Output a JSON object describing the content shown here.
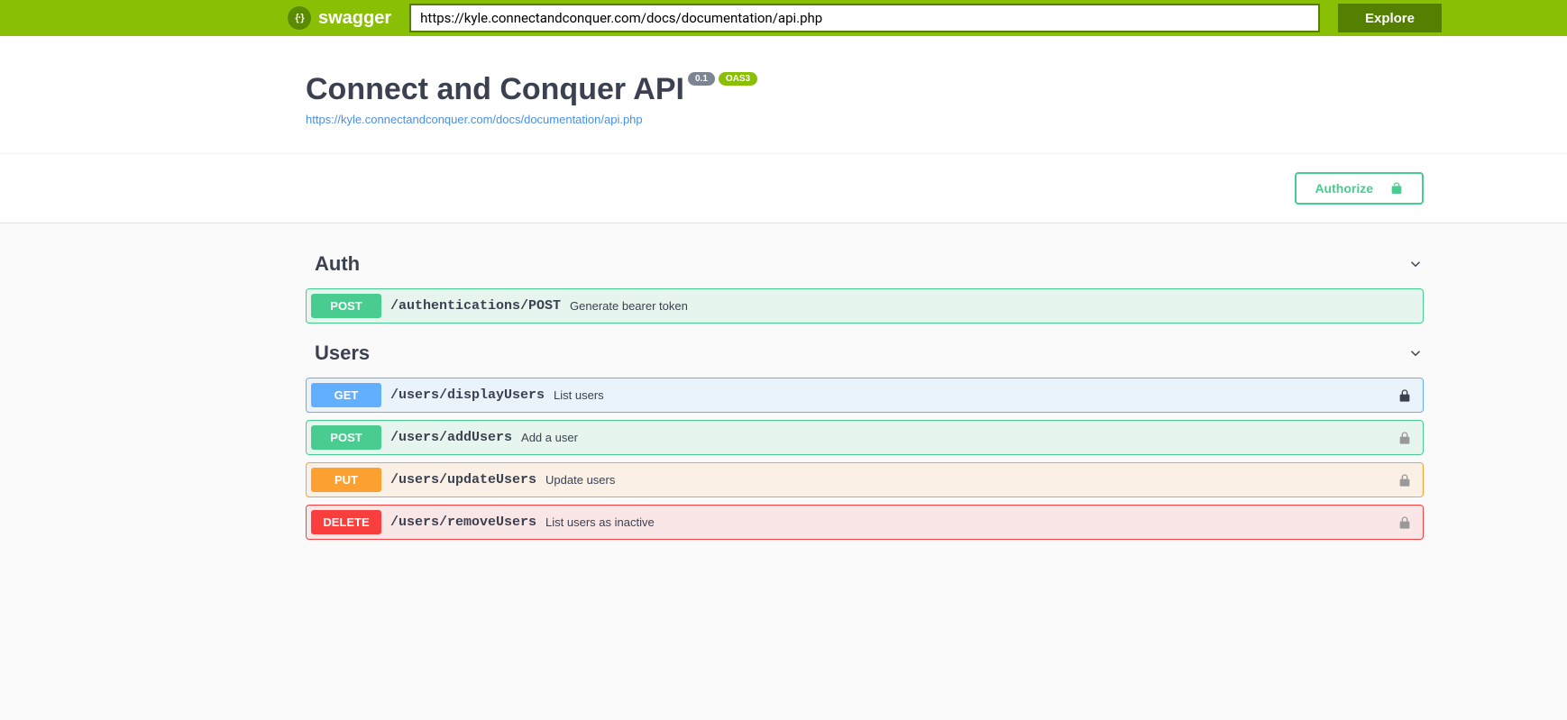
{
  "topbar": {
    "brand": "swagger",
    "url_value": "https://kyle.connectandconquer.com/docs/documentation/api.php",
    "explore_label": "Explore"
  },
  "info": {
    "title": "Connect and Conquer API",
    "version": "0.1",
    "oas_label": "OAS3",
    "spec_link": "https://kyle.connectandconquer.com/docs/documentation/api.php"
  },
  "authorize": {
    "label": "Authorize"
  },
  "tags": [
    {
      "name": "Auth",
      "operations": [
        {
          "method": "POST",
          "class": "post",
          "path": "/authentications/POST",
          "summary": "Generate bearer token",
          "locked": false
        }
      ]
    },
    {
      "name": "Users",
      "operations": [
        {
          "method": "GET",
          "class": "get",
          "path": "/users/displayUsers",
          "summary": "List users",
          "locked": true,
          "lock_dark": true
        },
        {
          "method": "POST",
          "class": "post",
          "path": "/users/addUsers",
          "summary": "Add a user",
          "locked": true,
          "lock_dark": false
        },
        {
          "method": "PUT",
          "class": "put",
          "path": "/users/updateUsers",
          "summary": "Update users",
          "locked": true,
          "lock_dark": false
        },
        {
          "method": "DELETE",
          "class": "delete",
          "path": "/users/removeUsers",
          "summary": "List users as inactive",
          "locked": true,
          "lock_dark": false
        }
      ]
    }
  ]
}
